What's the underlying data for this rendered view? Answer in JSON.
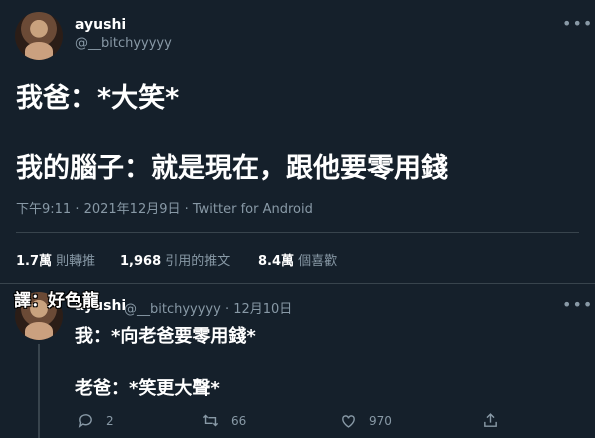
{
  "tweet": {
    "author_name": "ayushi",
    "author_handle": "@__bitchyyyyy",
    "line1": "我爸：*大笑*",
    "line2": "我的腦子：就是現在，跟他要零用錢",
    "timestamp": "下午9:11 · 2021年12月9日 · Twitter for Android",
    "stats": {
      "retweets_value": "1.7萬",
      "retweets_label": "則轉推",
      "quotes_value": "1,968",
      "quotes_label": "引用的推文",
      "likes_value": "8.4萬",
      "likes_label": "個喜歡"
    }
  },
  "reply": {
    "author_name": "ayushi",
    "author_handle": "@__bitchyyyyy · 12月10日",
    "line1": "我：*向老爸要零用錢*",
    "line2": "老爸：*笑更大聲*",
    "actions": {
      "reply_count": "2",
      "retweet_count": "66",
      "like_count": "970"
    }
  },
  "overlay": {
    "translator_credit": "譯：好色龍"
  },
  "icons": [
    "more-icon",
    "reply-icon",
    "retweet-icon",
    "like-icon",
    "share-icon"
  ],
  "colors": {
    "background": "#15202b",
    "muted": "#8899a6",
    "divider": "#38444d"
  }
}
